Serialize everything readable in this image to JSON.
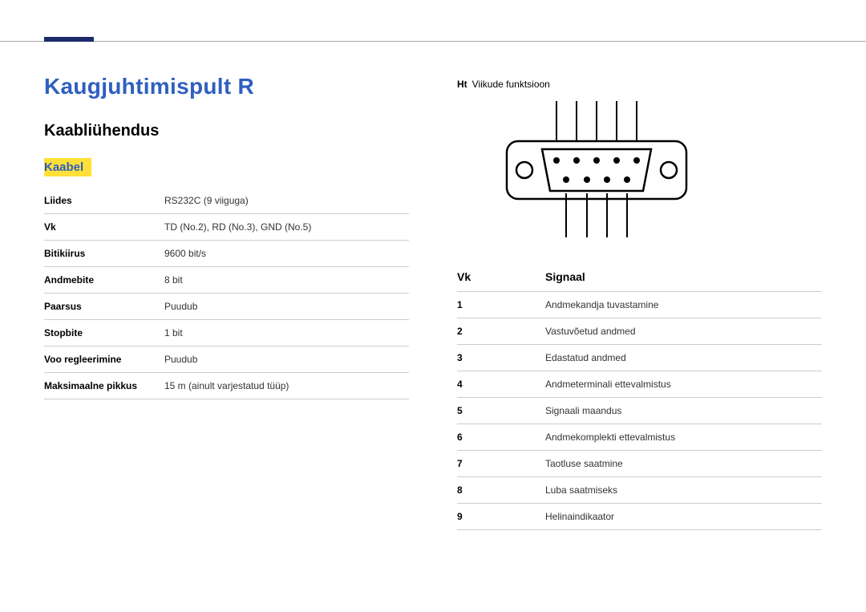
{
  "header_title": "Kaugjuhtimispult R",
  "section_title": "Kaabliühendus",
  "cable_label": "Kaabel",
  "specs": [
    {
      "label": "Liides",
      "value": "RS232C (9 viiguga)"
    },
    {
      "label": "Vk",
      "value": "TD (No.2), RD (No.3), GND (No.5)"
    },
    {
      "label": "Bitikiirus",
      "value": "9600 bit/s"
    },
    {
      "label": "Andmebite",
      "value": "8 bit"
    },
    {
      "label": "Paarsus",
      "value": "Puudub"
    },
    {
      "label": "Stopbite",
      "value": "1 bit"
    },
    {
      "label": "Voo regleerimine",
      "value": "Puudub"
    },
    {
      "label": "Maksimaalne pikkus",
      "value": "15 m (ainult varjestatud tüüp)"
    }
  ],
  "pin_header": {
    "bold": "Ht",
    "text": "Viikude funktsioon"
  },
  "pin_table_head": {
    "num": "Vk",
    "signal": "Signaal"
  },
  "pins": [
    {
      "n": "1",
      "s": "Andmekandja tuvastamine"
    },
    {
      "n": "2",
      "s": "Vastuvõetud andmed"
    },
    {
      "n": "3",
      "s": "Edastatud andmed"
    },
    {
      "n": "4",
      "s": "Andmeterminali ettevalmistus"
    },
    {
      "n": "5",
      "s": "Signaali maandus"
    },
    {
      "n": "6",
      "s": "Andmekomplekti ettevalmistus"
    },
    {
      "n": "7",
      "s": "Taotluse saatmine"
    },
    {
      "n": "8",
      "s": "Luba saatmiseks"
    },
    {
      "n": "9",
      "s": "Helinaindikaator"
    }
  ]
}
